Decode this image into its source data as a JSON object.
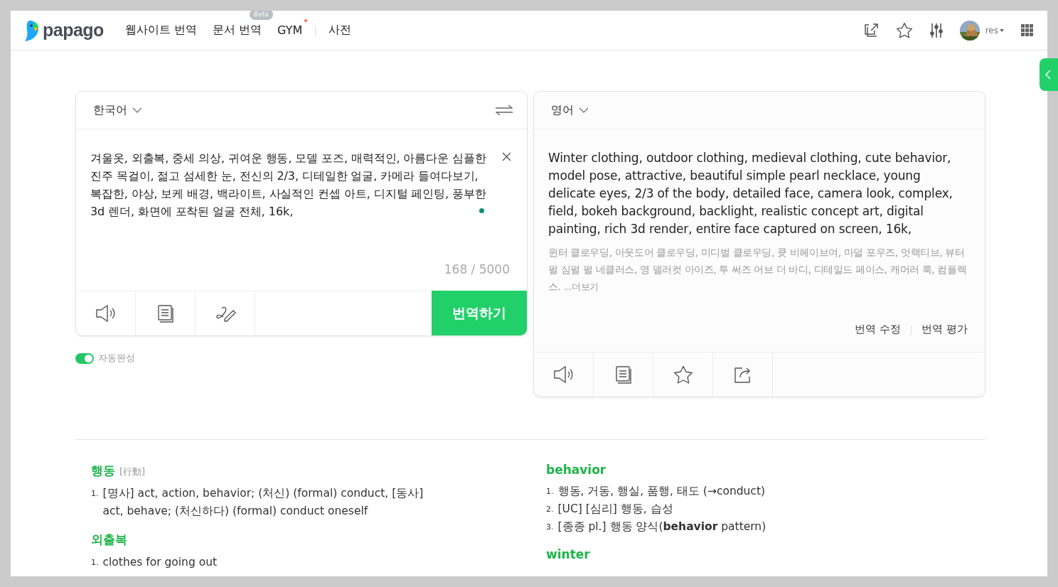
{
  "header": {
    "logo": "papago",
    "nav": [
      {
        "label": "웹사이트 번역"
      },
      {
        "label": "문서 번역",
        "badge": "Beta"
      },
      {
        "label": "GYM",
        "new": true
      },
      {
        "label": "사전"
      }
    ],
    "user": "res"
  },
  "source": {
    "language": "한국어",
    "text": "겨울옷, 외출복, 중세 의상, 귀여운 행동, 모델 포즈, 매력적인, 아름다운 심플한 진주 목걸이, 젊고 섬세한 눈, 전신의 2/3, 디테일한 얼굴, 카메라 들여다보기, 복잡한, 야상, 보케 배경, 백라이트, 사실적인 컨셉 아트, 디지털 페인팅, 풍부한 3d 렌더, 화면에 포착된 얼굴 전체, 16k,",
    "counter": "168 / 5000",
    "translate_button": "번역하기",
    "autocomplete": {
      "label": "자동완성",
      "on": true
    }
  },
  "target": {
    "language": "영어",
    "text": "Winter clothing, outdoor clothing, medieval clothing, cute behavior, model pose, attractive, beautiful simple pearl necklace, young delicate eyes, 2/3 of the body, detailed face, camera look, complex, field, bokeh background, backlight, realistic concept art, digital painting, rich 3d render, entire face captured on screen, 16k,",
    "pronunciation": "윈터 클로우딩, 아웃도어 클로우딩, 미디벌 클로우딩, 큣 비헤이브여, 마덜 포우즈, 엇랙티브, 뷰터펄 심펄 펄 네클러스, 영 델러컷 아이즈, 투 써즈 어브 더 바디, 디테일드 페이스, 캐머러 룩, 컴플렉스.",
    "more": "...더보기",
    "links": [
      "번역 수정",
      "번역 평가"
    ]
  },
  "dictionary": {
    "columns": [
      [
        {
          "word": "행동",
          "hanja": "[行動]",
          "senses": [
            {
              "num": "1.",
              "text": "[명사] act, action, behavior; (처신) (formal) conduct, [동사] act, behave; (처신하다) (formal) conduct oneself"
            }
          ]
        },
        {
          "word": "외출복",
          "senses": [
            {
              "num": "1.",
              "text": "clothes for going out"
            }
          ]
        }
      ],
      [
        {
          "word": "behavior",
          "senses": [
            {
              "num": "1.",
              "text": "행동, 거동, 행실, 품행, 태도 (→conduct)"
            },
            {
              "num": "2.",
              "text": "[UC] [심리] 행동, 습성"
            },
            {
              "num": "3.",
              "text": "[종종 pl.] 행동 양식(**behavior** pattern)"
            }
          ]
        },
        {
          "word": "winter"
        }
      ]
    ]
  }
}
